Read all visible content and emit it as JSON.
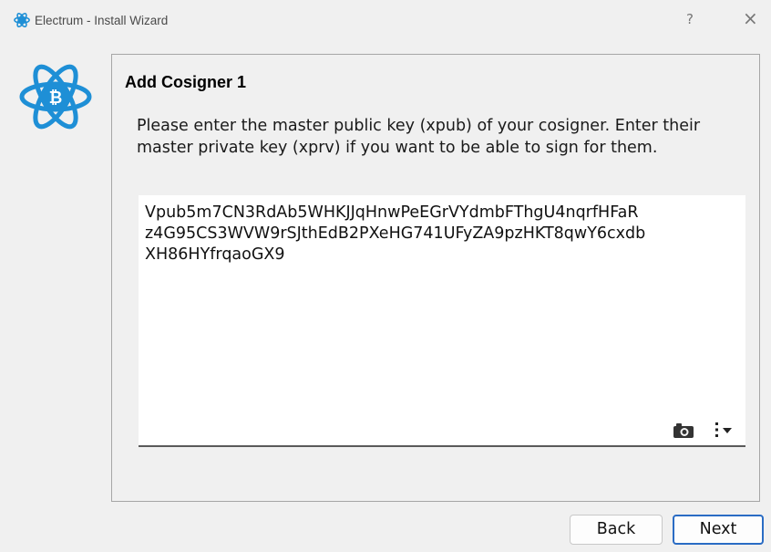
{
  "window": {
    "title": "Electrum  -  Install Wizard",
    "help_label": "?",
    "close_label": "×"
  },
  "panel": {
    "title": "Add Cosigner 1",
    "instructions": "Please enter the master public key (xpub) of your cosigner. Enter their master private key (xprv) if you want to be able to sign for them."
  },
  "key_input": {
    "lines": [
      "Vpub5m7CN3RdAb5WHKJJqHnwPeEGrVYdmbFThgU4nqrfHFaR",
      "z4G95CS3WVW9rSJthEdB2PXeHG741UFyZA9pzHKT8qwY6cxdb",
      "XH86HYfrqaoGX9"
    ]
  },
  "buttons": {
    "back": "Back",
    "next": "Next"
  },
  "colors": {
    "accent": "#2a6cc4",
    "logo_blue": "#1e8fd6"
  },
  "icons": [
    "electrum-logo-icon",
    "camera-icon",
    "menu-icon"
  ]
}
